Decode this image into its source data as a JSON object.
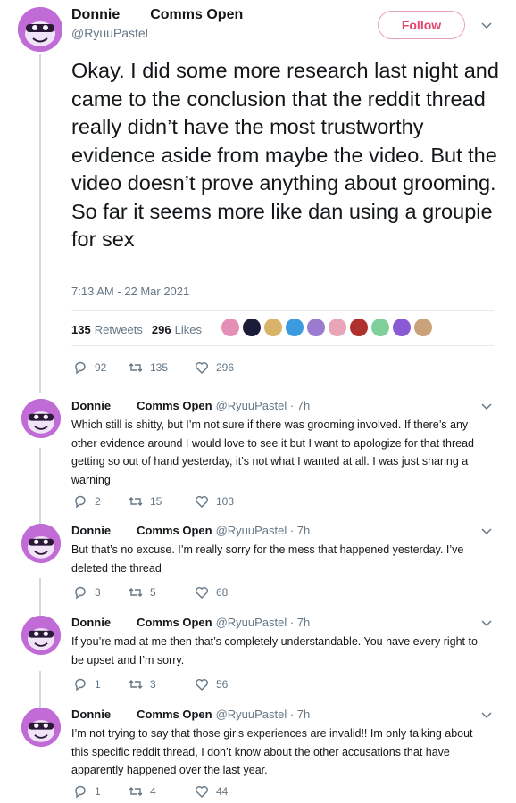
{
  "main_tweet": {
    "display_name": "Donnie",
    "name_tail": "Comms Open",
    "handle": "@RyuuPastel",
    "follow_label": "Follow",
    "text": "Okay. I did some more research last night and came to the conclusion that the reddit thread really didn’t have the most trustworthy evidence aside from maybe the video. But the video doesn’t prove anything about grooming. So far it seems more like dan using a groupie for sex",
    "timestamp": "7:13 AM - 22 Mar 2021",
    "retweets_count": "135",
    "retweets_label": "Retweets",
    "likes_count": "296",
    "likes_label": "Likes",
    "reply_count": "92",
    "retweet_count": "135",
    "like_count": "296",
    "liker_colors": [
      "#e58fb6",
      "#1b1b3a",
      "#d9b36a",
      "#3a9be0",
      "#9b7bd0",
      "#e9a5b8",
      "#b0302e",
      "#7fcf9a",
      "#8a5ad6",
      "#c9a27a"
    ]
  },
  "replies": [
    {
      "display_name": "Donnie",
      "name_tail": "Comms Open",
      "handle": "@RyuuPastel · 7h",
      "text": "Which still is shitty, but I’m not sure if there was grooming involved. If there’s any other evidence around I would love to see it but I want to apologize for that thread getting so out of hand yesterday, it’s not what I wanted at all. I was just sharing a warning",
      "reply_count": "2",
      "retweet_count": "15",
      "like_count": "103"
    },
    {
      "display_name": "Donnie",
      "name_tail": "Comms Open",
      "handle": "@RyuuPastel · 7h",
      "text": "But that’s no excuse. I’m really sorry for the mess that happened yesterday. I’ve deleted the thread",
      "reply_count": "3",
      "retweet_count": "5",
      "like_count": "68"
    },
    {
      "display_name": "Donnie",
      "name_tail": "Comms Open",
      "handle": "@RyuuPastel · 7h",
      "text": "If you’re mad at me then that’s completely understandable. You have every right to be upset and I’m sorry.",
      "reply_count": "1",
      "retweet_count": "3",
      "like_count": "56"
    },
    {
      "display_name": "Donnie",
      "name_tail": "Comms Open",
      "handle": "@RyuuPastel · 7h",
      "text": "I’m not trying to say that those girls experiences are invalid!! Im only talking about this specific reddit thread, I don’t know about the other accusations that have apparently happened over the last year.",
      "reply_count": "1",
      "retweet_count": "4",
      "like_count": "44"
    }
  ],
  "colors": {
    "avatar": "#c06bd6",
    "follow_accent": "#e0456f",
    "muted": "#657786"
  }
}
